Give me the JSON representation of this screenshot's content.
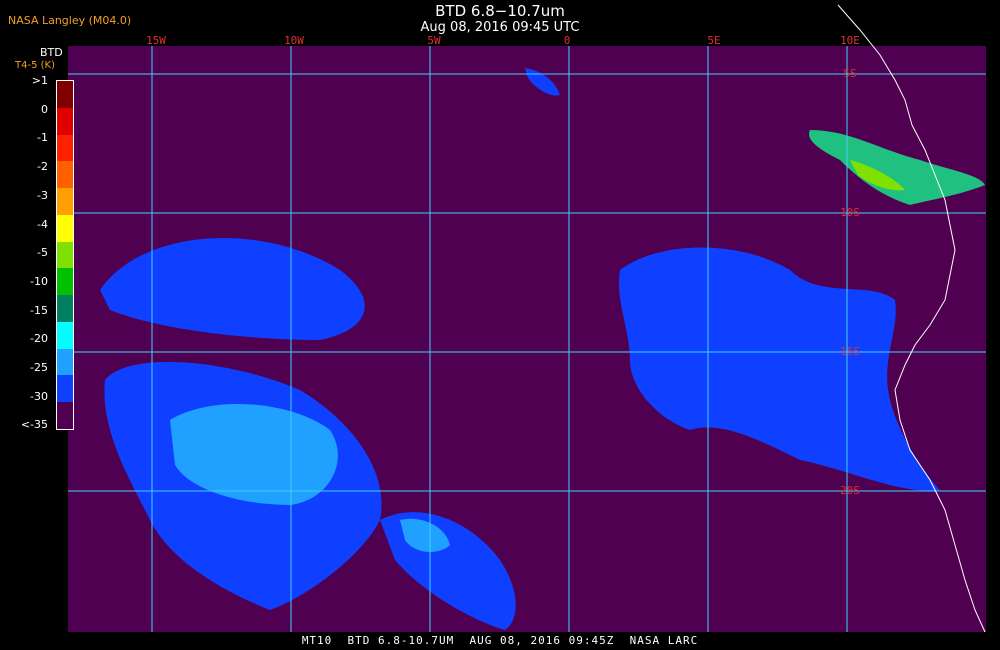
{
  "header": {
    "source": "NASA Langley (M04.0)",
    "title": "BTD 6.8−10.7um",
    "subtitle": "Aug 08, 2016 09:45 UTC"
  },
  "legend": {
    "title": "BTD",
    "subtitle": "T4-5 (K)",
    "labels": [
      ">1",
      "0",
      "-1",
      "-2",
      "-3",
      "-4",
      "-5",
      "-10",
      "-15",
      "-20",
      "-25",
      "-30",
      "<-35"
    ],
    "colors": [
      "#800000",
      "#e00000",
      "#ff2000",
      "#ff6000",
      "#ffa000",
      "#ffff00",
      "#80e000",
      "#00c000",
      "#008060",
      "#00ffff",
      "#20a0ff",
      "#1040ff",
      "#500050"
    ]
  },
  "map": {
    "background": "#500050",
    "grid_color": "#40d0ff",
    "lon_labels": [
      "15W",
      "10W",
      "5W",
      "0",
      "5E",
      "10E"
    ],
    "lat_labels": [
      "5S",
      "10S",
      "15S",
      "20S"
    ]
  },
  "footer": {
    "text": "MT10  BTD 6.8-10.7UM  AUG 08, 2016 09:45Z  NASA LARC"
  }
}
